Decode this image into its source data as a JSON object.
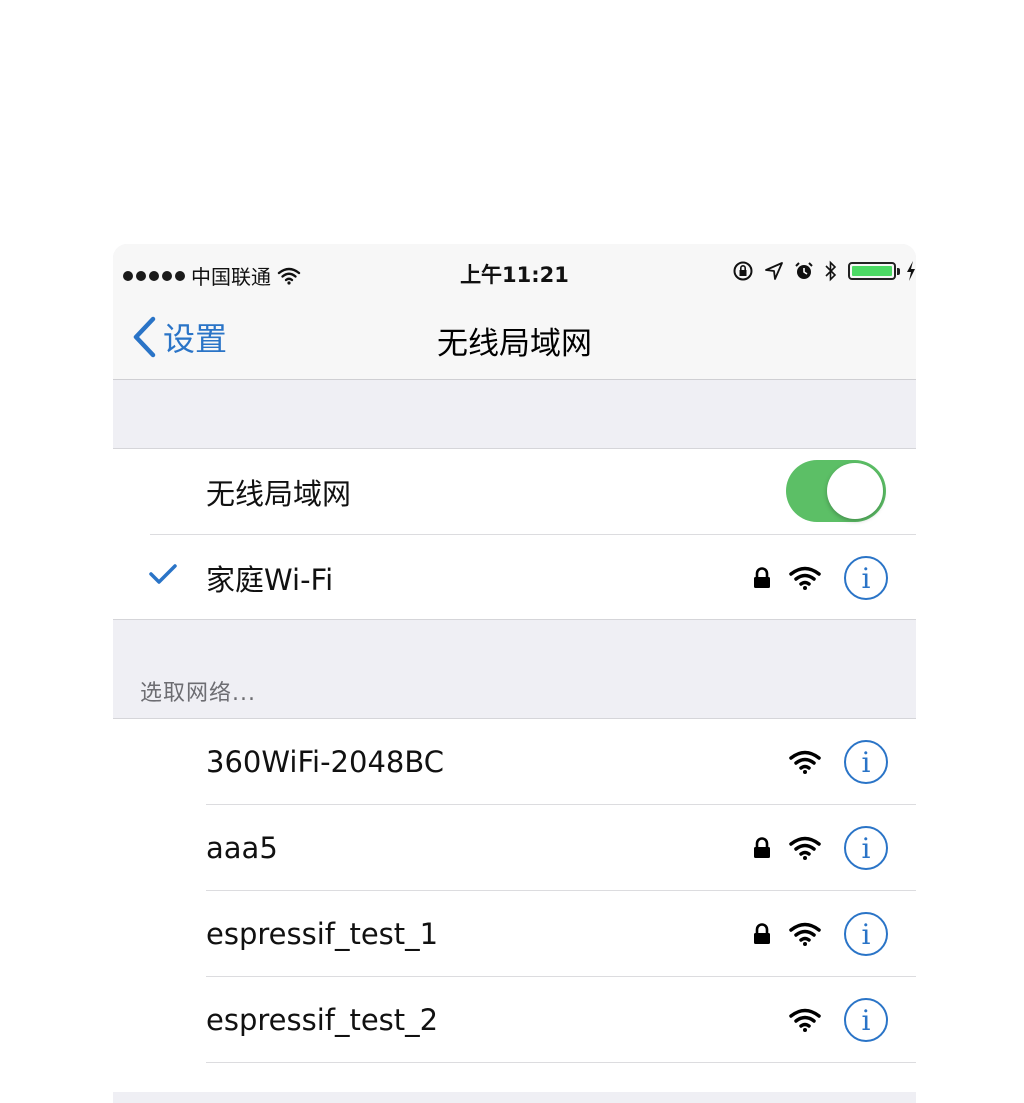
{
  "status_bar": {
    "carrier": "中国联通",
    "time": "上午11:21",
    "battery_color": "#4cd964"
  },
  "nav": {
    "back_label": "设置",
    "title": "无线局域网",
    "accent_color": "#2a74c7"
  },
  "wifi_toggle": {
    "label": "无线局域网",
    "on": true,
    "on_color": "#5cbf66"
  },
  "connected": {
    "name": "家庭Wi-Fi",
    "secured": true,
    "icons": [
      "checkmark-icon",
      "lock-icon",
      "wifi-signal-icon",
      "info-icon"
    ]
  },
  "section_header": "选取网络...",
  "networks": [
    {
      "name": "360WiFi-2048BC",
      "secured": false
    },
    {
      "name": "aaa5",
      "secured": true
    },
    {
      "name": "espressif_test_1",
      "secured": true
    },
    {
      "name": "espressif_test_2",
      "secured": false
    }
  ]
}
